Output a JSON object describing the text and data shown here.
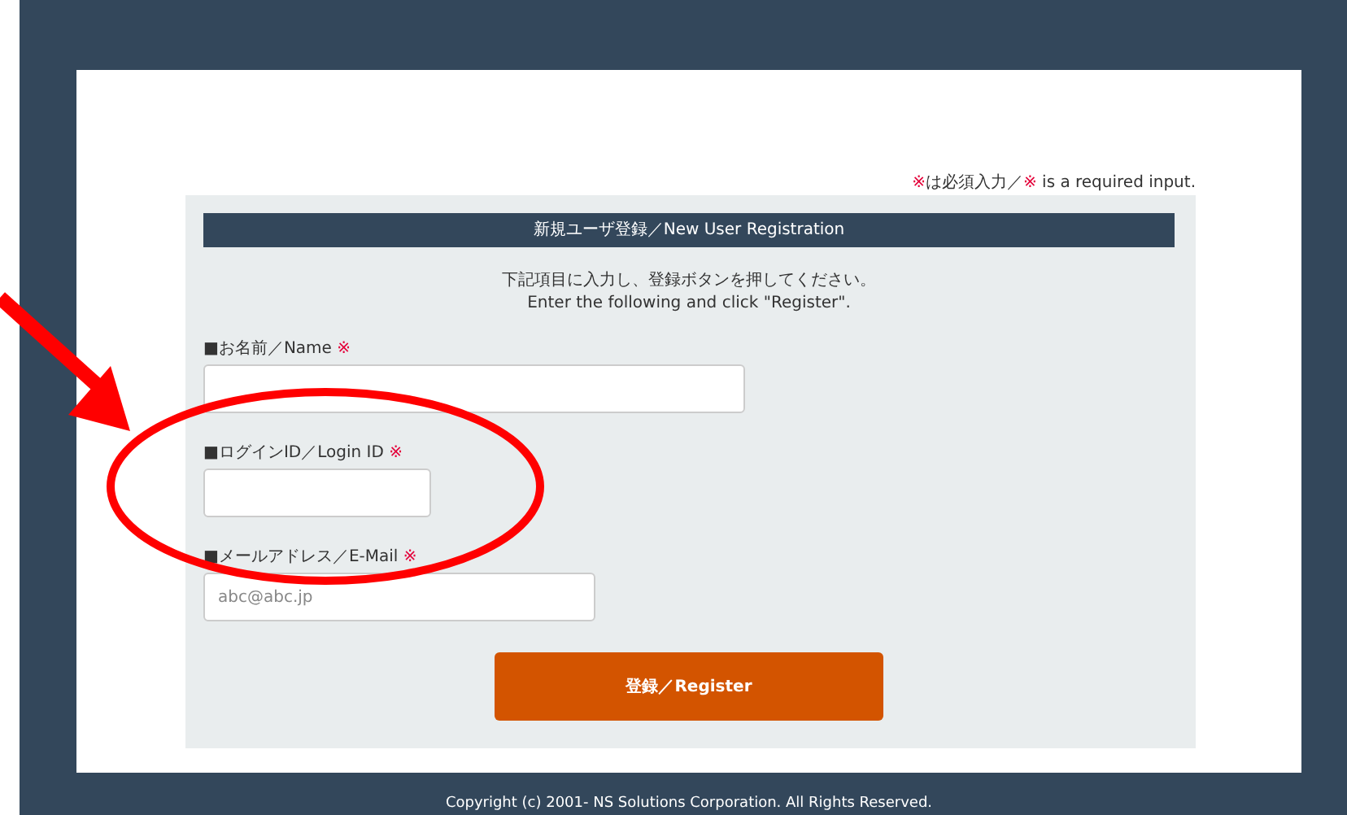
{
  "required_note": {
    "mark": "※",
    "text_ja": "は必須入力／",
    "text_en": " is a required input."
  },
  "form": {
    "title": "新規ユーザ登録／New User Registration",
    "instructions": [
      "下記項目に入力し、登録ボタンを押してください。",
      "Enter the following and click \"Register\"."
    ],
    "fields": [
      {
        "label": "■お名前／Name",
        "required_mark": "※"
      },
      {
        "label": "■ログインID／Login ID",
        "required_mark": "※"
      },
      {
        "label": "■メールアドレス／E-Mail",
        "required_mark": "※",
        "placeholder": "abc@abc.jp"
      }
    ],
    "submit": "登録／Register"
  },
  "footer": "Copyright (c) 2001- NS Solutions Corporation. All Rights Reserved."
}
